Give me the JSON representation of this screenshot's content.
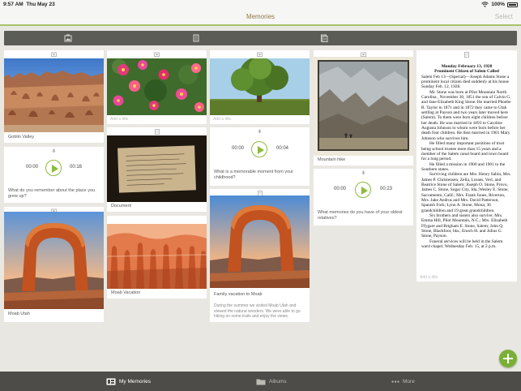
{
  "status_bar": {
    "time": "9:57 AM",
    "date": "Thu May 23",
    "battery": "100%"
  },
  "nav": {
    "title": "Memories",
    "select_label": "Select"
  },
  "filters": [
    {
      "icon": "photo-filter-icon"
    },
    {
      "icon": "document-filter-icon"
    },
    {
      "icon": "story-filter-icon"
    }
  ],
  "cards": {
    "goblin_valley": {
      "caption": "Goblin Valley"
    },
    "audio_place": {
      "current": "00:00",
      "duration": "00:16",
      "prompt": "What do you remember about the place you grew up?"
    },
    "moab_utah": {
      "caption": "Moab Utah"
    },
    "flowers": {
      "placeholder": "Add a title."
    },
    "document": {
      "caption": "Document"
    },
    "moab_vacation": {
      "caption": "Moab Vacation"
    },
    "tree": {
      "placeholder": "Add a title."
    },
    "audio_moment": {
      "current": "00:00",
      "duration": "00:04",
      "prompt": "What is a memorable moment from your childhood?"
    },
    "family_vacation": {
      "caption": "Family vacation to Moab",
      "description": "During the summer we visited Moab Utah and viewed the natural wonders. We were able to go hiking on some trails and enjoy the views."
    },
    "mountain_hike": {
      "caption": "Mountain hike"
    },
    "audio_relatives": {
      "current": "00:00",
      "duration": "00:23",
      "prompt": "What memories do you have of your oldest relatives?"
    },
    "obituary": {
      "placeholder": "Add a title.",
      "dateline": "Monday February 13, 1928",
      "headline": "Prominent Citizen of Salem Called",
      "paragraphs": [
        "Salem Feb 13—(Special)—Joseph Adams Stone a prominent local citizen died suddenly at his house Sunday Feb. 12, 1928.",
        "Mr. Stone was born at Pilot Mountain North Carolina , November 30, 1851 the son of Calvin G. and Jane Elizabeth King Stone. He married Phoebe B. Taylor in 1871 and in 1872 they came to Utah settling at Payson and two years later moved here (Salem). To them were born eight children before her death. He was married in 1893 to Caroline Augusta Johnson to whom were born before her death four children. He then married in 1901 Mary Johnson who survives him.",
        "He filled many important positions of trust being school trustee more than 15 years and a member of the Salem canal board and town board for a long period.",
        "He filled a mission in 1900 and 1901 to the Southern states.",
        "Surviving children are Mrs. Henry Sabin, Mrs. James P. Christensen, Zella, Loraes, Verl, and Beatrice Stone of Salem; Joseph O. Stone, Provo, James C. Stone, Sugar City, Ida.;Wesley E. Stone, Sacramento, Calif.; Mrs. Frank Jones, Riverton, Mrs. Jake Andrus and Mrs. David Patterson, Spanish Fork; Lynn A. Stone, Mona; 36 grandchildren and 19 great grandchildren.",
        "Six brothers and sisters also survive; Mrs. Emma Hill, Pilot Mountain, N.C.; Mrs. Elizabeth Ffygare and Brigham E. Stone, Salem; John Q. Stone, Blackfoot, Ida.; Enoch H. and Julius G. Stone, Payson.",
        "Funeral services will be held in the Salem ward chapel, Wednesday Feb. 15, at 2 p.m."
      ]
    }
  },
  "tabs": [
    {
      "label": "My Memories",
      "icon": "memories-tab-icon",
      "active": true
    },
    {
      "label": "Albums",
      "icon": "folder-tab-icon",
      "active": false
    },
    {
      "label": "More",
      "icon": "more-dots-icon",
      "active": false
    }
  ],
  "colors": {
    "accent_green": "#79b035",
    "nav_title": "#8f7a45",
    "tab_bar": "#4d4c48",
    "filter_bar": "#5c5c57"
  }
}
